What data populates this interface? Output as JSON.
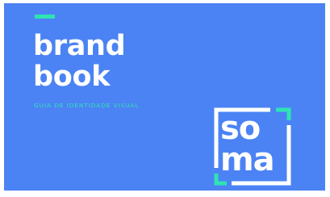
{
  "cover": {
    "title_line1": "brand",
    "title_line2": "book",
    "subtitle": "GUIA DE IDENTIDADE VISUAL"
  },
  "logo": {
    "line1": "so",
    "line2": "ma"
  },
  "colors": {
    "background": "#4b83f4",
    "accent": "#2fe3b3",
    "text": "#ffffff"
  }
}
